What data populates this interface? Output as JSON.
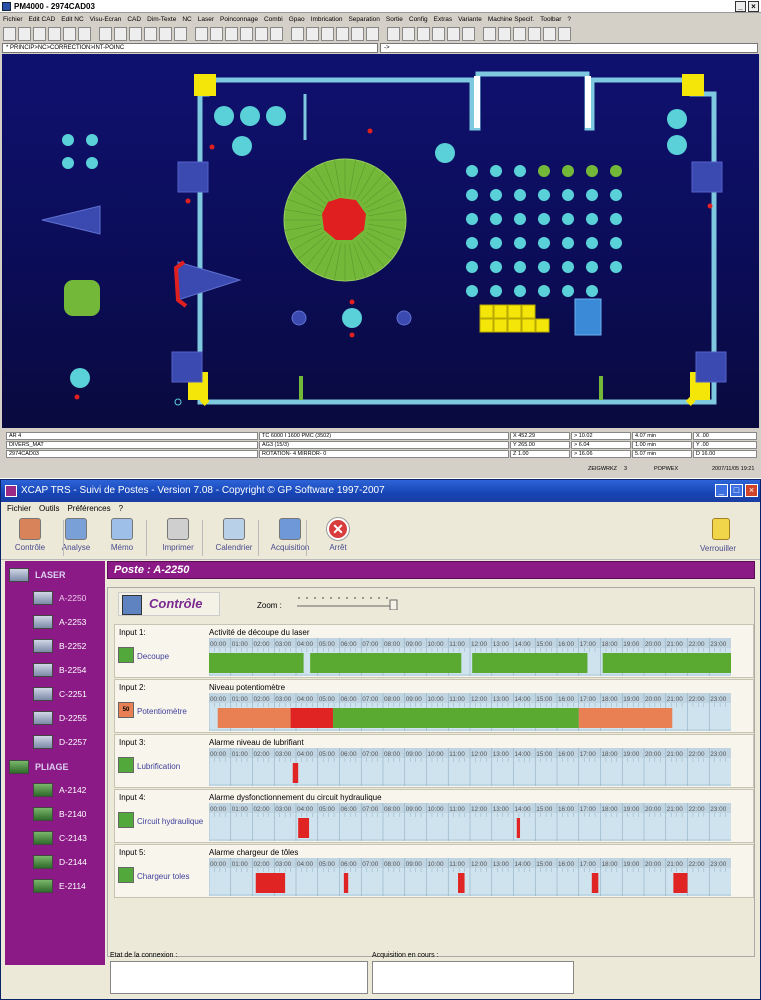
{
  "cad": {
    "title": "PM4000 - 2974CAD03",
    "menu": [
      "Fichier",
      "Edit CAD",
      "Edit NC",
      "Visu-Ecran",
      "CAD",
      "Dim-Texte",
      "NC",
      "Laser",
      "Poinconnage",
      "Combi",
      "Gpao",
      "Imbrication",
      "Separation",
      "Sortie",
      "Config",
      "Extras",
      "Variante",
      "Machine Specif.",
      "Toolbar",
      "?"
    ],
    "path_left": "* PRINCIP>NC>CORRECTION>INT-POINC",
    "path_right": "->",
    "status": {
      "f1": "AR   4",
      "f2": "DIVERS_MAT",
      "f3": "2974CAD03",
      "g1": "TC 6000 I 1600 PMC    (3502)",
      "g2": "AG3                    (15/3)",
      "g3": "ROTATION-  4      MIRROR-  0",
      "x": "X  452.29",
      "y": "Y  265.00",
      "z": "Z    1.00",
      "dx": ">   10.02",
      "dy": ">    6.04",
      "dz": ">   16.06",
      "t1": "4.07 min",
      "t2": "1.00 min",
      "t3": "5.07 min",
      "a1": "X    .00",
      "a2": "Y    .00",
      "a3": "D   16.00",
      "c1": "ZEIGWRKZ",
      "c2": "3",
      "c3": "POPWEX",
      "c4": "2007/11/05 19:21"
    },
    "colors": {
      "outline": "#7ec8e0",
      "green": "#74b83a",
      "cyan": "#5ad0d8",
      "yellow": "#f5e60a",
      "red": "#e02020",
      "block": "#3b4ab0"
    }
  },
  "xcap": {
    "title": "XCAP TRS  - Suivi de Postes - Version 7.08 - Copyright © GP Software 1997-2007",
    "menu": [
      "Fichier",
      "Outils",
      "Préférences",
      "?"
    ],
    "tools": [
      "Contrôle",
      "Analyse",
      "Mémo",
      "Imprimer",
      "Calendrier",
      "Acquisition",
      "Arrêt"
    ],
    "lock": "Verrouiller",
    "sidebar": {
      "laser": "LASER",
      "laser_items": [
        "A-2250",
        "A-2253",
        "B-2252",
        "B-2254",
        "C-2251",
        "D-2255",
        "D-2257"
      ],
      "pliage": "PLIAGE",
      "pliage_items": [
        "A-2142",
        "B-2140",
        "C-2143",
        "D-2144",
        "E-2114"
      ]
    },
    "poste": "Poste : A-2250",
    "control": "Contrôle",
    "zoom": "Zoom :",
    "hours": [
      "00:00",
      "01:00",
      "02:00",
      "03:00",
      "04:00",
      "05:00",
      "06:00",
      "07:00",
      "08:00",
      "09:00",
      "10:00",
      "11:00",
      "12:00",
      "13:00",
      "14:00",
      "15:00",
      "16:00",
      "17:00",
      "18:00",
      "19:00",
      "20:00",
      "21:00",
      "22:00",
      "23:00"
    ],
    "inputs": [
      {
        "label": "Input 1:",
        "name": "Decoupe",
        "desc": "Activité de découpe du laser",
        "icon": "green",
        "icon_text": "",
        "segments": [
          {
            "from": 0,
            "to": 4.35,
            "color": "#5aaa32"
          },
          {
            "from": 4.65,
            "to": 11.6,
            "color": "#5aaa32"
          },
          {
            "from": 12.1,
            "to": 17.4,
            "color": "#5aaa32"
          },
          {
            "from": 18.1,
            "to": 24,
            "color": "#5aaa32"
          }
        ]
      },
      {
        "label": "Input 2:",
        "name": "Potentiomètre",
        "desc": "Niveau potentiomètre",
        "icon": "orange",
        "icon_text": "50",
        "segments": [
          {
            "from": 0.4,
            "to": 3.75,
            "color": "#e88054"
          },
          {
            "from": 3.75,
            "to": 5.7,
            "color": "#e02424"
          },
          {
            "from": 5.7,
            "to": 17.0,
            "color": "#5aaa32"
          },
          {
            "from": 17.0,
            "to": 21.3,
            "color": "#e88054"
          }
        ]
      },
      {
        "label": "Input 3:",
        "name": "Lubrification",
        "desc": "Alarme niveau de lubrifiant",
        "icon": "green",
        "icon_text": "",
        "segments": [
          {
            "from": 3.85,
            "to": 4.1,
            "color": "#e02424"
          }
        ]
      },
      {
        "label": "Input 4:",
        "name": "Circuit hydraulique",
        "desc": "Alarme dysfonctionnement du circuit hydraulique",
        "icon": "green",
        "icon_text": "",
        "segments": [
          {
            "from": 4.1,
            "to": 4.6,
            "color": "#e02424"
          },
          {
            "from": 14.15,
            "to": 14.3,
            "color": "#e02424"
          }
        ]
      },
      {
        "label": "Input 5:",
        "name": "Chargeur toles",
        "desc": "Alarme chargeur de tôles",
        "icon": "green",
        "icon_text": "",
        "segments": [
          {
            "from": 2.15,
            "to": 3.5,
            "color": "#e02424"
          },
          {
            "from": 6.2,
            "to": 6.4,
            "color": "#e02424"
          },
          {
            "from": 11.45,
            "to": 11.75,
            "color": "#e02424"
          },
          {
            "from": 17.6,
            "to": 17.9,
            "color": "#e02424"
          },
          {
            "from": 21.35,
            "to": 22.0,
            "color": "#e02424"
          }
        ]
      }
    ],
    "conn_label": "Etat de la connexion :",
    "acq_label": "Acquisition en cours :"
  }
}
